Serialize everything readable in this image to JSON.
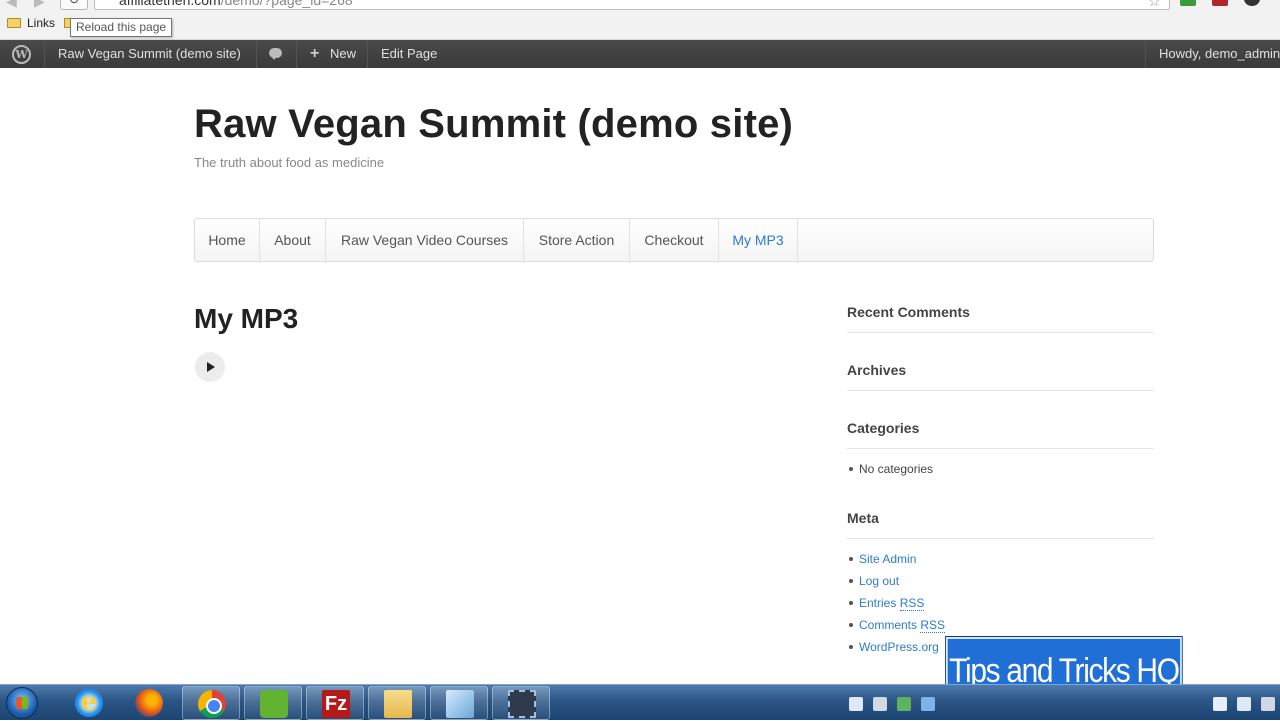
{
  "browser": {
    "url_prefix": "affiliatethen.com",
    "url_rest": "/demo/?page_id=268",
    "tooltip": "Reload this page",
    "bookmark_label": "Links"
  },
  "adminbar": {
    "site_name": "Raw Vegan Summit (demo site)",
    "new_label": "New",
    "edit_label": "Edit Page",
    "howdy": "Howdy, demo_admin"
  },
  "site": {
    "title": "Raw Vegan Summit (demo site)",
    "tagline": "The truth about food as medicine"
  },
  "nav": {
    "items": [
      {
        "label": "Home"
      },
      {
        "label": "About"
      },
      {
        "label": "Raw Vegan Video Courses"
      },
      {
        "label": "Store Action"
      },
      {
        "label": "Checkout"
      },
      {
        "label": "My MP3"
      }
    ]
  },
  "page": {
    "title": "My MP3"
  },
  "sidebar": {
    "recent_comments": "Recent Comments",
    "archives": "Archives",
    "categories": "Categories",
    "categories_items": [
      "No categories"
    ],
    "meta": "Meta",
    "meta_items": {
      "site_admin": "Site Admin",
      "log_out": "Log out",
      "entries": "Entries",
      "comments": "Comments",
      "rss": "RSS",
      "wordpress": "WordPress.org"
    }
  },
  "watermark": "Tips and Tricks HQ",
  "colors": {
    "accent": "#2e7bcf",
    "adminbar": "#464646",
    "watermark_bg": "#1f6fd6"
  }
}
